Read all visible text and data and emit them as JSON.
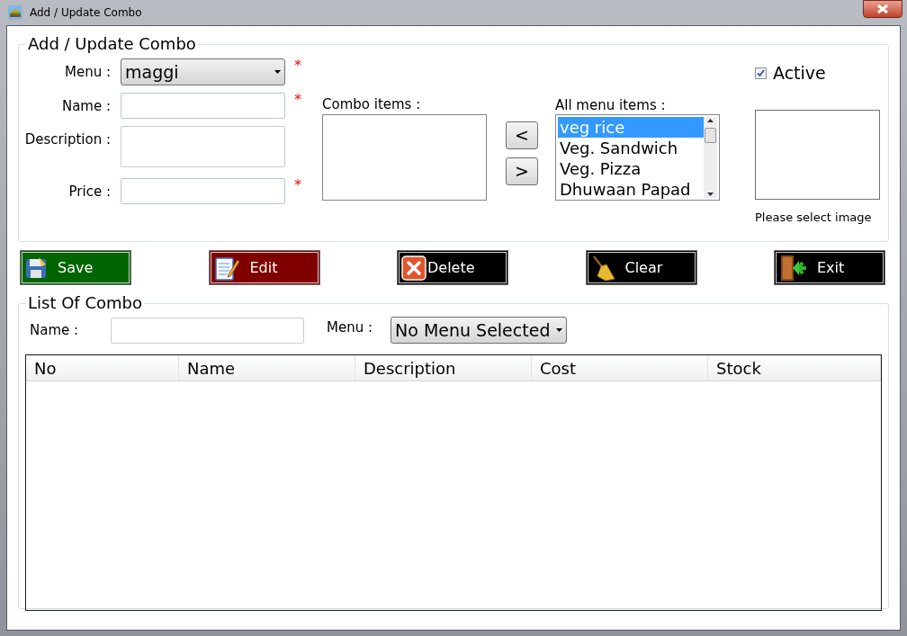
{
  "window": {
    "title": "Add / Update Combo"
  },
  "form": {
    "legend": "Add / Update Combo",
    "fields": [
      {
        "kind": "dropdown",
        "label": "Menu :",
        "value": "maggi",
        "required_mark": "*"
      },
      {
        "kind": "text",
        "label": "Name :",
        "required_mark": "*"
      },
      {
        "kind": "multiline",
        "label": "Description :"
      },
      {
        "kind": "text",
        "label": "Price :",
        "required_mark": "*"
      }
    ],
    "combo_items": {
      "label": "Combo items :"
    },
    "move_buttons": [
      "<",
      ">"
    ],
    "all_menu_items": {
      "label": "All menu items :",
      "items": [
        {
          "text": "veg rice",
          "selected": true
        },
        {
          "text": "Veg. Sandwich",
          "selected": false
        },
        {
          "text": "Veg. Pizza",
          "selected": false
        },
        {
          "text": "Dhuwaan Papad",
          "selected": false
        }
      ]
    },
    "active": {
      "label": "Active",
      "checked": true
    },
    "image": {
      "caption": "Please select image"
    }
  },
  "actions": [
    {
      "kind": "save",
      "label": "Save",
      "color": "#006400"
    },
    {
      "kind": "edit",
      "label": "Edit",
      "color": "#800000"
    },
    {
      "kind": "delete",
      "label": "Delete",
      "color": "#000000"
    },
    {
      "kind": "clear",
      "label": "Clear",
      "color": "#000000"
    },
    {
      "kind": "exit",
      "label": "Exit",
      "color": "#000000"
    }
  ],
  "list": {
    "legend": "List Of Combo",
    "filter": {
      "name_label": "Name :",
      "menu_label": "Menu :",
      "menu_value": "No Menu Selected"
    },
    "table": {
      "columns": [
        "No",
        "Name",
        "Description",
        "Cost",
        "Stock"
      ]
    }
  }
}
